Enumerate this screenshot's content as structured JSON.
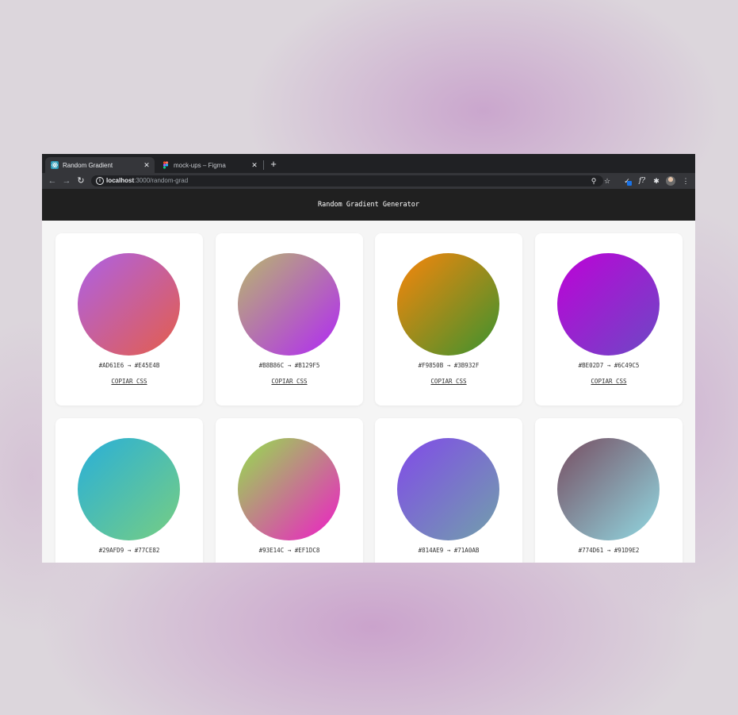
{
  "browser": {
    "tabs": [
      {
        "title": "Random Gradient",
        "active": true,
        "favicon": "react-icon"
      },
      {
        "title": "mock-ups – Figma",
        "active": false,
        "favicon": "figma-icon"
      }
    ],
    "url_host": "localhost",
    "url_path": ":3000/random-grad"
  },
  "app": {
    "title": "Random Gradient Generator",
    "copy_label": "COPIAR CSS"
  },
  "gradients": [
    {
      "from": "#AD61E6",
      "to": "#E45E4B",
      "label": "#AD61E6 → #E45E4B"
    },
    {
      "from": "#B8B86C",
      "to": "#B129F5",
      "label": "#B8B86C → #B129F5"
    },
    {
      "from": "#F9850B",
      "to": "#3B932F",
      "label": "#F9850B → #3B932F"
    },
    {
      "from": "#BE02D7",
      "to": "#6C49C5",
      "label": "#BE02D7 → #6C49C5"
    },
    {
      "from": "#29AFD9",
      "to": "#77CE82",
      "label": "#29AFD9 → #77CE82"
    },
    {
      "from": "#93E14C",
      "to": "#EF1DC8",
      "label": "#93E14C → #EF1DC8"
    },
    {
      "from": "#814AE9",
      "to": "#71A0AB",
      "label": "#814AE9 → #71A0AB"
    },
    {
      "from": "#774D61",
      "to": "#91D9E2",
      "label": "#774D61 → #91D9E2"
    }
  ]
}
